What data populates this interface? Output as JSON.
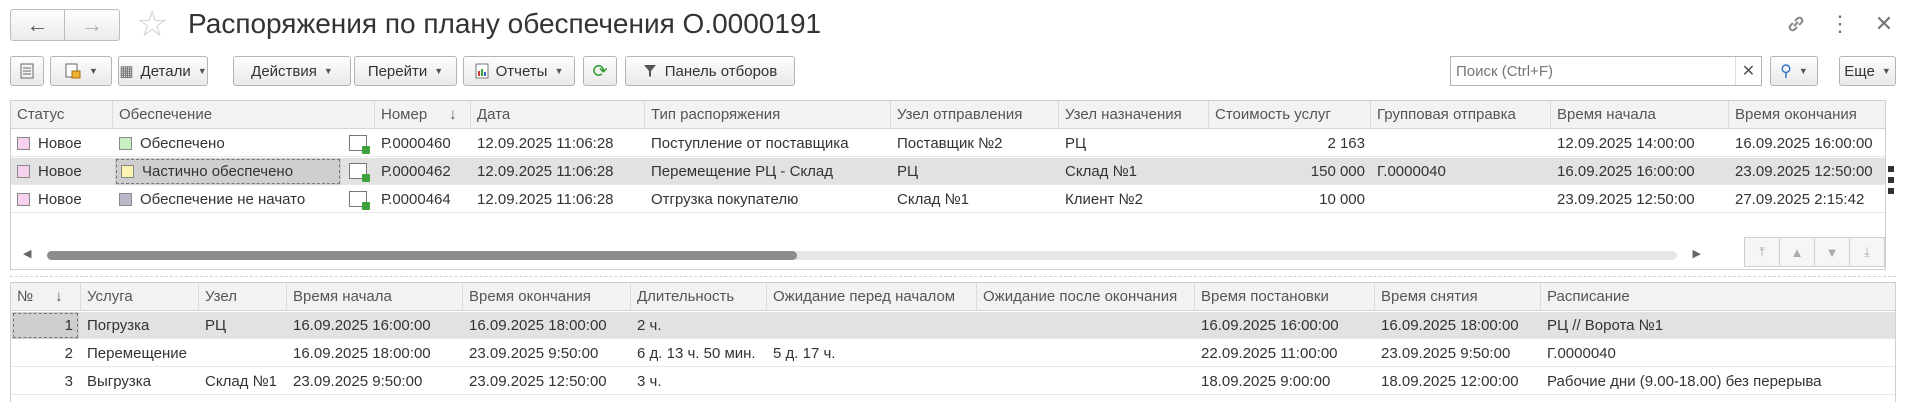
{
  "window": {
    "title": "Распоряжения по плану обеспечения О.0000191"
  },
  "toolbar": {
    "details_label": "Детали",
    "actions_label": "Действия",
    "goto_label": "Перейти",
    "reports_label": "Отчеты",
    "filter_panel_label": "Панель отборов",
    "search_placeholder": "Поиск (Ctrl+F)",
    "more_label": "Еще"
  },
  "orders": {
    "columns": [
      "Статус",
      "Обеспечение",
      "Номер",
      "Дата",
      "Тип распоряжения",
      "Узел отправления",
      "Узел назначения",
      "Стоимость услуг",
      "Групповая отправка",
      "Время начала",
      "Время окончания"
    ],
    "rows": [
      {
        "status": "Новое",
        "status_color": "#f7d0ee",
        "supply": "Обеспечено",
        "supply_color": "#c8f0c0",
        "number": "Р.0000460",
        "date": "12.09.2025 11:06:28",
        "type": "Поступление от поставщика",
        "from": "Поставщик №2",
        "to": "РЦ",
        "cost": "2 163",
        "group": "",
        "start": "12.09.2025 14:00:00",
        "end": "16.09.2025 16:00:00"
      },
      {
        "status": "Новое",
        "status_color": "#f7d0ee",
        "supply": "Частично обеспечено",
        "supply_color": "#fbf3b0",
        "number": "Р.0000462",
        "date": "12.09.2025 11:06:28",
        "type": "Перемещение РЦ - Склад",
        "from": "РЦ",
        "to": "Склад №1",
        "cost": "150 000",
        "group": "Г.0000040",
        "start": "16.09.2025 16:00:00",
        "end": "23.09.2025 12:50:00"
      },
      {
        "status": "Новое",
        "status_color": "#f7d0ee",
        "supply": "Обеспечение не начато",
        "supply_color": "#b8b8c8",
        "number": "Р.0000464",
        "date": "12.09.2025 11:06:28",
        "type": "Отгрузка покупателю",
        "from": "Склад №1",
        "to": "Клиент №2",
        "cost": "10 000",
        "group": "",
        "start": "23.09.2025 12:50:00",
        "end": "27.09.2025 2:15:42"
      }
    ]
  },
  "services": {
    "columns": [
      "№",
      "Услуга",
      "Узел",
      "Время начала",
      "Время окончания",
      "Длительность",
      "Ожидание перед началом",
      "Ожидание после окончания",
      "Время постановки",
      "Время снятия",
      "Расписание"
    ],
    "rows": [
      {
        "n": "1",
        "service": "Погрузка",
        "node": "РЦ",
        "start": "16.09.2025 16:00:00",
        "end": "16.09.2025 18:00:00",
        "duration": "2 ч.",
        "wait_before": "",
        "wait_after": "",
        "placed": "16.09.2025 16:00:00",
        "removed": "16.09.2025 18:00:00",
        "schedule": "РЦ // Ворота №1"
      },
      {
        "n": "2",
        "service": "Перемещение",
        "node": "",
        "start": "16.09.2025 18:00:00",
        "end": "23.09.2025 9:50:00",
        "duration": "6 д. 13 ч. 50 мин.",
        "wait_before": "5 д. 17 ч.",
        "wait_after": "",
        "placed": "22.09.2025 11:00:00",
        "removed": "23.09.2025 9:50:00",
        "schedule": "Г.0000040"
      },
      {
        "n": "3",
        "service": "Выгрузка",
        "node": "Склад №1",
        "start": "23.09.2025 9:50:00",
        "end": "23.09.2025 12:50:00",
        "duration": "3 ч.",
        "wait_before": "",
        "wait_after": "",
        "placed": "18.09.2025 9:00:00",
        "removed": "18.09.2025 12:00:00",
        "schedule": "Рабочие дни (9.00-18.00) без перерыва"
      }
    ]
  }
}
